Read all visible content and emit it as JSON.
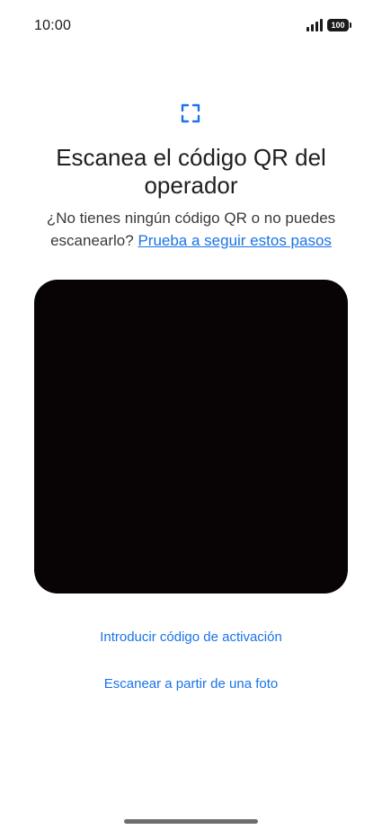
{
  "status_bar": {
    "time": "10:00",
    "battery_level": "100",
    "signal_icon": "signal-bars-icon",
    "battery_icon": "battery-icon"
  },
  "header": {
    "icon": "qr-scan-icon",
    "title": "Escanea el código QR del operador",
    "subtitle_text": "¿No tienes ningún código QR o no puedes escanearlo? ",
    "help_link": "Prueba a seguir estos pasos"
  },
  "actions": {
    "enter_code_label": "Introducir código de activación",
    "scan_photo_label": "Escanear a partir de una foto"
  },
  "colors": {
    "accent": "#1a73e8",
    "viewfinder": "#080304",
    "background": "#ffffff"
  }
}
